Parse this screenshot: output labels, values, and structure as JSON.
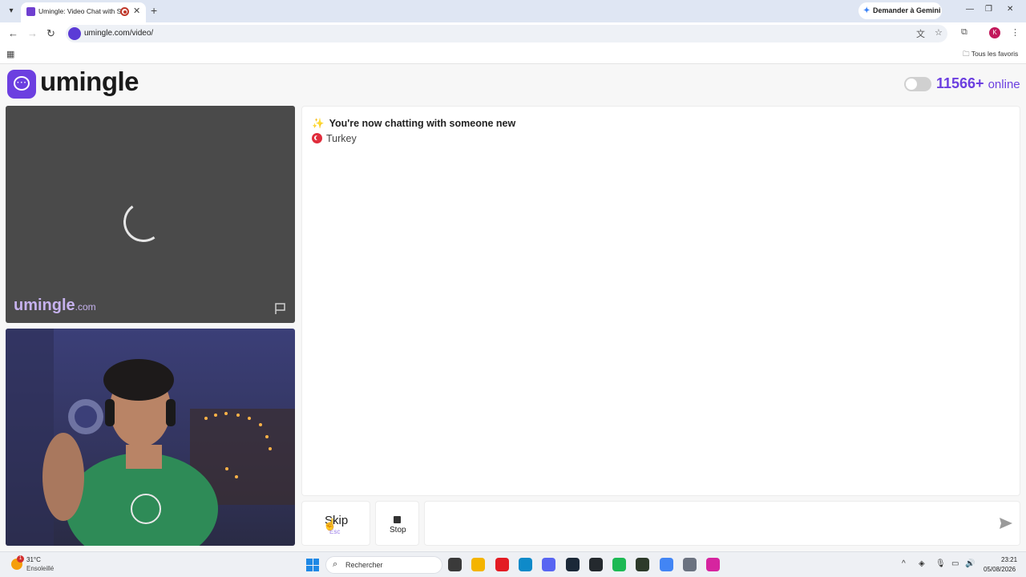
{
  "browser": {
    "tab_title": "Umingle: Video Chat with S",
    "new_tab": "+",
    "gemini_label": "Demander à Gemini",
    "url": "umingle.com/video/",
    "profile_initial": "K",
    "bookmarks_all": "Tous les favoris"
  },
  "site": {
    "logo_text": "umingle",
    "online_count": "11566+",
    "online_label": "online",
    "watermark_brand": "umingle",
    "watermark_domain": ".com"
  },
  "chat": {
    "new_partner_msg": "You're now chatting with someone new",
    "partner_country": "Turkey",
    "sparkle": "✨"
  },
  "controls": {
    "skip_label": "Skip",
    "skip_key": "Esc",
    "stop_label": "Stop",
    "message_value": "",
    "message_placeholder": ""
  },
  "taskbar": {
    "temperature": "31°C",
    "condition": "Ensoleillé",
    "weather_badge": "1",
    "search_placeholder": "Rechercher",
    "time": "23:21",
    "date": "05/08/2026",
    "apps": [
      {
        "name": "file-manager-icon",
        "color": "#3a3a3a"
      },
      {
        "name": "folder-icon",
        "color": "#f4b400"
      },
      {
        "name": "opera-icon",
        "color": "#e31b23"
      },
      {
        "name": "edge-icon",
        "color": "#0e8ac9"
      },
      {
        "name": "discord-icon",
        "color": "#5865f2"
      },
      {
        "name": "steam-icon",
        "color": "#1b2838"
      },
      {
        "name": "github-icon",
        "color": "#24292e"
      },
      {
        "name": "spotify-icon",
        "color": "#1db954"
      },
      {
        "name": "winamp-icon",
        "color": "#2d3a2a"
      },
      {
        "name": "chrome-icon",
        "color": "#4285f4"
      },
      {
        "name": "settings-icon",
        "color": "#6b7280"
      },
      {
        "name": "instagram-icon",
        "color": "#d6249f"
      }
    ]
  },
  "colors": {
    "accent": "#6c3fe0",
    "video_bg": "#4a4a4a"
  }
}
